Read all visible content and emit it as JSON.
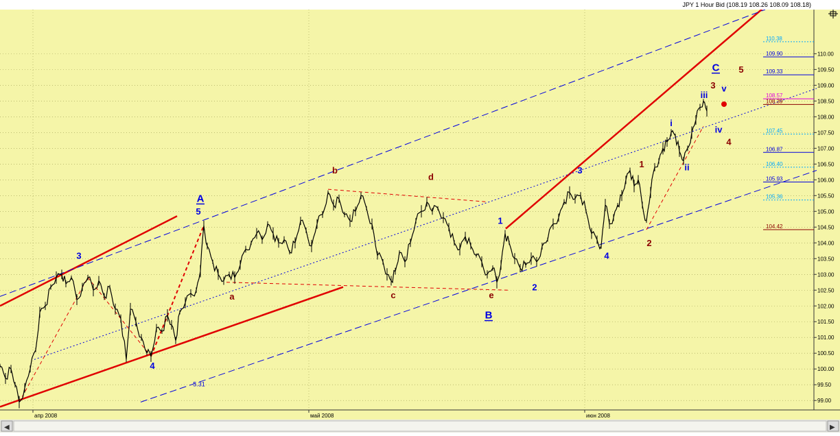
{
  "header": {
    "title": "JPY 1 Hour Bid (108.19 108.26 108.09 108.18)"
  },
  "colors": {
    "background": "#f5f5a8",
    "grid": "#9a9a50",
    "price": "#000000",
    "red": "#e00000",
    "blue": "#0000e0",
    "dark_red": "#8b0000",
    "cyan": "#00a8ff",
    "magenta": "#e000e0"
  },
  "chart_data": {
    "type": "line",
    "title": "JPY 1 Hour Bid (108.19 108.26 108.09 108.18)",
    "instrument": "JPY",
    "timeframe": "1 Hour",
    "last_bar": {
      "open": 108.19,
      "high": 108.26,
      "low": 108.09,
      "close": 108.18
    },
    "xlabel": "",
    "ylabel": "",
    "ylim": [
      98.7,
      111.4
    ],
    "y_ticks": [
      "99.00",
      "99.50",
      "100.00",
      "100.50",
      "101.00",
      "101.50",
      "102.00",
      "102.50",
      "103.00",
      "103.50",
      "104.00",
      "104.50",
      "105.00",
      "105.50",
      "106.00",
      "106.50",
      "107.00",
      "107.50",
      "108.00",
      "108.50",
      "109.00",
      "109.50",
      "110.00"
    ],
    "x_ticks": [
      "апр 2008",
      "май 2008",
      "июн 2008"
    ],
    "grid": true,
    "price_path": [
      {
        "t": 0,
        "v": 100.1
      },
      {
        "t": 8,
        "v": 99.7
      },
      {
        "t": 16,
        "v": 100.0
      },
      {
        "t": 22,
        "v": 99.5
      },
      {
        "t": 28,
        "v": 98.95
      },
      {
        "t": 36,
        "v": 99.4
      },
      {
        "t": 44,
        "v": 100.0
      },
      {
        "t": 52,
        "v": 100.6
      },
      {
        "t": 58,
        "v": 101.8
      },
      {
        "t": 66,
        "v": 102.0
      },
      {
        "t": 74,
        "v": 102.6
      },
      {
        "t": 82,
        "v": 102.9
      },
      {
        "t": 90,
        "v": 103.0
      },
      {
        "t": 96,
        "v": 102.7
      },
      {
        "t": 104,
        "v": 102.9
      },
      {
        "t": 112,
        "v": 102.2
      },
      {
        "t": 120,
        "v": 102.6
      },
      {
        "t": 128,
        "v": 102.9
      },
      {
        "t": 136,
        "v": 102.5
      },
      {
        "t": 144,
        "v": 102.8
      },
      {
        "t": 152,
        "v": 102.3
      },
      {
        "t": 160,
        "v": 102.6
      },
      {
        "t": 168,
        "v": 101.9
      },
      {
        "t": 176,
        "v": 101.6
      },
      {
        "t": 184,
        "v": 100.3
      },
      {
        "t": 190,
        "v": 101.9
      },
      {
        "t": 198,
        "v": 101.5
      },
      {
        "t": 206,
        "v": 101.0
      },
      {
        "t": 214,
        "v": 100.5
      },
      {
        "t": 220,
        "v": 100.4
      },
      {
        "t": 228,
        "v": 101.3
      },
      {
        "t": 236,
        "v": 101.2
      },
      {
        "t": 244,
        "v": 101.7
      },
      {
        "t": 250,
        "v": 101.4
      },
      {
        "t": 256,
        "v": 100.9
      },
      {
        "t": 262,
        "v": 101.8
      },
      {
        "t": 270,
        "v": 102.1
      },
      {
        "t": 278,
        "v": 102.4
      },
      {
        "t": 286,
        "v": 102.5
      },
      {
        "t": 292,
        "v": 103.1
      },
      {
        "t": 297,
        "v": 104.55
      },
      {
        "t": 302,
        "v": 103.9
      },
      {
        "t": 310,
        "v": 103.4
      },
      {
        "t": 318,
        "v": 103.0
      },
      {
        "t": 326,
        "v": 102.8
      },
      {
        "t": 334,
        "v": 103.0
      },
      {
        "t": 342,
        "v": 102.9
      },
      {
        "t": 350,
        "v": 103.3
      },
      {
        "t": 358,
        "v": 103.8
      },
      {
        "t": 366,
        "v": 104.0
      },
      {
        "t": 374,
        "v": 104.3
      },
      {
        "t": 382,
        "v": 104.1
      },
      {
        "t": 390,
        "v": 104.6
      },
      {
        "t": 398,
        "v": 104.3
      },
      {
        "t": 406,
        "v": 104.0
      },
      {
        "t": 414,
        "v": 104.1
      },
      {
        "t": 422,
        "v": 103.7
      },
      {
        "t": 430,
        "v": 104.0
      },
      {
        "t": 438,
        "v": 104.7
      },
      {
        "t": 446,
        "v": 104.4
      },
      {
        "t": 454,
        "v": 103.9
      },
      {
        "t": 462,
        "v": 104.6
      },
      {
        "t": 470,
        "v": 104.9
      },
      {
        "t": 478,
        "v": 105.6
      },
      {
        "t": 486,
        "v": 105.2
      },
      {
        "t": 494,
        "v": 105.4
      },
      {
        "t": 502,
        "v": 104.9
      },
      {
        "t": 510,
        "v": 104.7
      },
      {
        "t": 518,
        "v": 105.0
      },
      {
        "t": 526,
        "v": 105.5
      },
      {
        "t": 534,
        "v": 105.1
      },
      {
        "t": 542,
        "v": 104.6
      },
      {
        "t": 550,
        "v": 103.6
      },
      {
        "t": 558,
        "v": 103.4
      },
      {
        "t": 564,
        "v": 103.0
      },
      {
        "t": 570,
        "v": 102.8
      },
      {
        "t": 576,
        "v": 103.1
      },
      {
        "t": 582,
        "v": 103.7
      },
      {
        "t": 590,
        "v": 103.4
      },
      {
        "t": 598,
        "v": 104.0
      },
      {
        "t": 606,
        "v": 104.7
      },
      {
        "t": 614,
        "v": 105.0
      },
      {
        "t": 622,
        "v": 105.3
      },
      {
        "t": 630,
        "v": 105.0
      },
      {
        "t": 638,
        "v": 105.1
      },
      {
        "t": 646,
        "v": 104.8
      },
      {
        "t": 654,
        "v": 104.5
      },
      {
        "t": 662,
        "v": 104.0
      },
      {
        "t": 670,
        "v": 103.8
      },
      {
        "t": 678,
        "v": 104.2
      },
      {
        "t": 686,
        "v": 103.9
      },
      {
        "t": 694,
        "v": 103.6
      },
      {
        "t": 702,
        "v": 103.4
      },
      {
        "t": 710,
        "v": 103.0
      },
      {
        "t": 718,
        "v": 103.2
      },
      {
        "t": 724,
        "v": 102.75
      },
      {
        "t": 730,
        "v": 103.3
      },
      {
        "t": 736,
        "v": 104.3
      },
      {
        "t": 742,
        "v": 104.0
      },
      {
        "t": 750,
        "v": 103.5
      },
      {
        "t": 758,
        "v": 103.2
      },
      {
        "t": 766,
        "v": 103.3
      },
      {
        "t": 774,
        "v": 103.5
      },
      {
        "t": 782,
        "v": 103.4
      },
      {
        "t": 790,
        "v": 103.9
      },
      {
        "t": 798,
        "v": 104.1
      },
      {
        "t": 806,
        "v": 104.6
      },
      {
        "t": 814,
        "v": 104.8
      },
      {
        "t": 822,
        "v": 105.3
      },
      {
        "t": 830,
        "v": 105.6
      },
      {
        "t": 838,
        "v": 105.4
      },
      {
        "t": 846,
        "v": 105.5
      },
      {
        "t": 854,
        "v": 105.0
      },
      {
        "t": 862,
        "v": 104.3
      },
      {
        "t": 870,
        "v": 104.1
      },
      {
        "t": 876,
        "v": 103.9
      },
      {
        "t": 882,
        "v": 105.2
      },
      {
        "t": 888,
        "v": 104.6
      },
      {
        "t": 894,
        "v": 104.8
      },
      {
        "t": 900,
        "v": 105.2
      },
      {
        "t": 906,
        "v": 105.5
      },
      {
        "t": 912,
        "v": 106.0
      },
      {
        "t": 918,
        "v": 106.3
      },
      {
        "t": 924,
        "v": 105.8
      },
      {
        "t": 930,
        "v": 106.0
      },
      {
        "t": 936,
        "v": 105.2
      },
      {
        "t": 942,
        "v": 104.7
      },
      {
        "t": 948,
        "v": 105.6
      },
      {
        "t": 954,
        "v": 106.4
      },
      {
        "t": 960,
        "v": 106.6
      },
      {
        "t": 966,
        "v": 107.0
      },
      {
        "t": 972,
        "v": 107.2
      },
      {
        "t": 978,
        "v": 107.5
      },
      {
        "t": 984,
        "v": 107.4
      },
      {
        "t": 990,
        "v": 106.9
      },
      {
        "t": 996,
        "v": 106.6
      },
      {
        "t": 1002,
        "v": 107.0
      },
      {
        "t": 1008,
        "v": 107.5
      },
      {
        "t": 1014,
        "v": 107.9
      },
      {
        "t": 1020,
        "v": 108.3
      },
      {
        "t": 1025,
        "v": 108.5
      },
      {
        "t": 1030,
        "v": 108.18
      }
    ],
    "annotations": [
      {
        "text": "3",
        "color": "blue",
        "t": 115,
        "v": 103.5
      },
      {
        "text": "4",
        "color": "blue",
        "t": 222,
        "v": 100.0
      },
      {
        "text": "A",
        "color": "blue",
        "t": 292,
        "v": 105.3,
        "underline": true
      },
      {
        "text": "5",
        "color": "blue",
        "t": 289,
        "v": 104.9
      },
      {
        "text": "a",
        "color": "dark_red",
        "t": 338,
        "v": 102.2
      },
      {
        "text": "b",
        "color": "dark_red",
        "t": 488,
        "v": 106.2
      },
      {
        "text": "c",
        "color": "dark_red",
        "t": 573,
        "v": 102.25
      },
      {
        "text": "d",
        "color": "dark_red",
        "t": 628,
        "v": 106.0
      },
      {
        "text": "e",
        "color": "dark_red",
        "t": 716,
        "v": 102.25
      },
      {
        "text": "B",
        "color": "blue",
        "t": 712,
        "v": 101.6,
        "underline": true
      },
      {
        "text": "1",
        "color": "blue",
        "t": 729,
        "v": 104.6
      },
      {
        "text": "2",
        "color": "blue",
        "t": 779,
        "v": 102.5
      },
      {
        "text": "3",
        "color": "blue",
        "t": 845,
        "v": 106.2
      },
      {
        "text": "4",
        "color": "blue",
        "t": 884,
        "v": 103.5
      },
      {
        "text": "1",
        "color": "dark_red",
        "t": 935,
        "v": 106.4
      },
      {
        "text": "2",
        "color": "dark_red",
        "t": 946,
        "v": 103.9
      },
      {
        "text": "i",
        "color": "blue",
        "t": 978,
        "v": 107.7
      },
      {
        "text": "ii",
        "color": "blue",
        "t": 1001,
        "v": 106.3
      },
      {
        "text": "iii",
        "color": "blue",
        "t": 1026,
        "v": 108.6
      },
      {
        "text": "iv",
        "color": "blue",
        "t": 1047,
        "v": 107.5
      },
      {
        "text": "v",
        "color": "blue",
        "t": 1055,
        "v": 108.8
      },
      {
        "text": "3",
        "color": "dark_red",
        "t": 1039,
        "v": 108.9
      },
      {
        "text": "4",
        "color": "dark_red",
        "t": 1062,
        "v": 107.1
      },
      {
        "text": "5",
        "color": "dark_red",
        "t": 1080,
        "v": 109.4
      },
      {
        "text": "C",
        "color": "blue",
        "t": 1043,
        "v": 109.45,
        "underline": true
      },
      {
        "text": "5.31",
        "color": "blue",
        "t": 290,
        "v": 99.45
      }
    ],
    "levels": [
      {
        "label": "110.38",
        "value": 110.38,
        "color": "cyan"
      },
      {
        "label": "109.90",
        "value": 109.9,
        "color": "blue"
      },
      {
        "label": "109.33",
        "value": 109.33,
        "color": "blue"
      },
      {
        "label": "108.57",
        "value": 108.57,
        "color": "magenta"
      },
      {
        "label": "108.39",
        "value": 108.39,
        "color": "dark_red"
      },
      {
        "label": "107.45",
        "value": 107.45,
        "color": "cyan"
      },
      {
        "label": "106.87",
        "value": 106.87,
        "color": "blue"
      },
      {
        "label": "106.40",
        "value": 106.4,
        "color": "cyan"
      },
      {
        "label": "105.93",
        "value": 105.93,
        "color": "blue"
      },
      {
        "label": "105.36",
        "value": 105.36,
        "color": "cyan"
      },
      {
        "label": "104.42",
        "value": 104.42,
        "color": "dark_red"
      }
    ],
    "trend_lines": [
      {
        "name": "channel-upper-left",
        "color": "red",
        "width": 2.5,
        "dash": false,
        "p1": {
          "t": 0,
          "v": 102.0
        },
        "p2": {
          "t": 258,
          "v": 104.85
        }
      },
      {
        "name": "channel-lower-left",
        "color": "red",
        "width": 2.5,
        "dash": false,
        "p1": {
          "t": 0,
          "v": 98.8
        },
        "p2": {
          "t": 500,
          "v": 102.6
        }
      },
      {
        "name": "channel-upper-right",
        "color": "red",
        "width": 2.5,
        "dash": false,
        "p1": {
          "t": 737,
          "v": 104.45
        },
        "p2": {
          "t": 1115,
          "v": 111.5
        }
      },
      {
        "name": "blue-dash-upper",
        "color": "blue",
        "width": 1,
        "dash": true,
        "p1": {
          "t": 0,
          "v": 102.3
        },
        "p2": {
          "t": 1115,
          "v": 111.4
        }
      },
      {
        "name": "blue-dash-lower",
        "color": "blue",
        "width": 1,
        "dash": true,
        "p1": {
          "t": 205,
          "v": 98.95
        },
        "p2": {
          "t": 1190,
          "v": 106.3
        }
      },
      {
        "name": "blue-dot-mid",
        "color": "blue",
        "width": 1,
        "dash": "dot",
        "p1": {
          "t": 50,
          "v": 100.3
        },
        "p2": {
          "t": 1190,
          "v": 108.9
        }
      },
      {
        "name": "triangle-upper",
        "color": "red",
        "width": 1,
        "dash": true,
        "p1": {
          "t": 478,
          "v": 105.7
        },
        "p2": {
          "t": 710,
          "v": 105.3
        }
      },
      {
        "name": "triangle-lower",
        "color": "red",
        "width": 1,
        "dash": true,
        "p1": {
          "t": 330,
          "v": 102.75
        },
        "p2": {
          "t": 740,
          "v": 102.5
        }
      },
      {
        "name": "zigzag-1",
        "color": "red",
        "width": 1,
        "dash": true,
        "p1": {
          "t": 28,
          "v": 98.95
        },
        "p2": {
          "t": 128,
          "v": 102.9
        }
      },
      {
        "name": "zigzag-2",
        "color": "red",
        "width": 1,
        "dash": true,
        "p1": {
          "t": 128,
          "v": 102.9
        },
        "p2": {
          "t": 220,
          "v": 100.4
        }
      },
      {
        "name": "zigzag-3",
        "color": "red",
        "width": 2,
        "dash": true,
        "p1": {
          "t": 220,
          "v": 100.4
        },
        "p2": {
          "t": 297,
          "v": 104.55
        }
      },
      {
        "name": "zigzag-4",
        "color": "red",
        "width": 1,
        "dash": true,
        "p1": {
          "t": 942,
          "v": 104.42
        },
        "p2": {
          "t": 1025,
          "v": 107.7
        }
      }
    ],
    "marker": {
      "t": 1055,
      "v": 108.4,
      "color": "red"
    }
  }
}
